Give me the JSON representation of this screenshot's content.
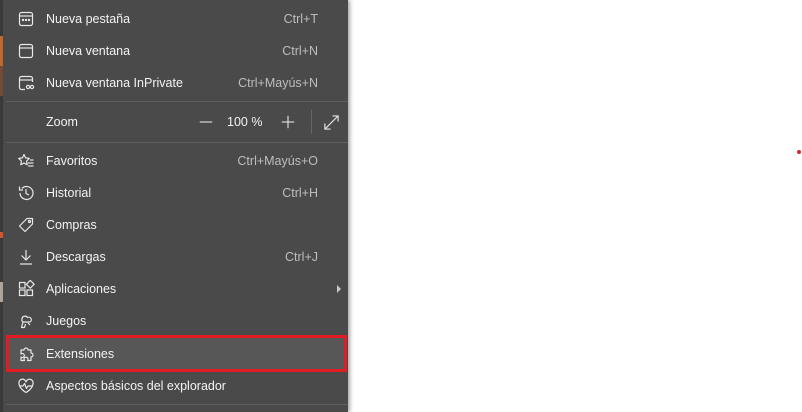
{
  "menu": {
    "items": [
      {
        "id": "new-tab",
        "label": "Nueva pestaña",
        "shortcut": "Ctrl+T",
        "icon": "new-tab-icon"
      },
      {
        "id": "new-window",
        "label": "Nueva ventana",
        "shortcut": "Ctrl+N",
        "icon": "window-icon"
      },
      {
        "id": "inprivate",
        "label": "Nueva ventana InPrivate",
        "shortcut": "Ctrl+Mayús+N",
        "icon": "inprivate-icon"
      },
      {
        "id": "favorites",
        "label": "Favoritos",
        "shortcut": "Ctrl+Mayús+O",
        "icon": "star-list-icon"
      },
      {
        "id": "history",
        "label": "Historial",
        "shortcut": "Ctrl+H",
        "icon": "history-icon"
      },
      {
        "id": "shopping",
        "label": "Compras",
        "shortcut": "",
        "icon": "tag-icon"
      },
      {
        "id": "downloads",
        "label": "Descargas",
        "shortcut": "Ctrl+J",
        "icon": "download-icon"
      },
      {
        "id": "apps",
        "label": "Aplicaciones",
        "shortcut": "",
        "icon": "apps-icon",
        "submenu": true
      },
      {
        "id": "games",
        "label": "Juegos",
        "shortcut": "",
        "icon": "games-icon"
      },
      {
        "id": "extensions",
        "label": "Extensiones",
        "shortcut": "",
        "icon": "puzzle-icon",
        "highlighted": true
      },
      {
        "id": "essentials",
        "label": "Aspectos básicos del explorador",
        "shortcut": "",
        "icon": "heart-pulse-icon"
      }
    ],
    "zoom": {
      "label": "Zoom",
      "value": "100 %",
      "minus_icon": "minus-icon",
      "plus_icon": "plus-icon",
      "fullscreen_icon": "fullscreen-icon"
    }
  },
  "colors": {
    "menu_bg": "#4a4a4a",
    "highlight_border": "#e31b23",
    "text": "#f3f3f3",
    "shortcut_text": "#bdbdbd"
  }
}
